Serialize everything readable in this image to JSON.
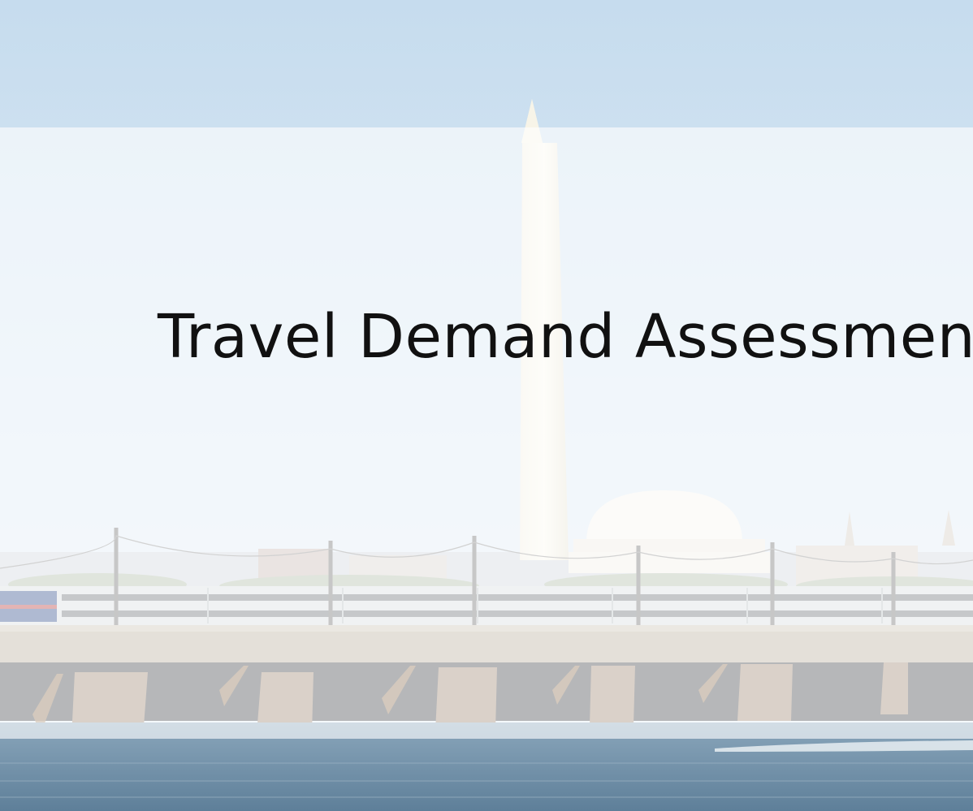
{
  "slide": {
    "title": "Travel Demand Assessment"
  },
  "colors": {
    "sky_top": "#c9dff0",
    "sky_mid": "#e4eef7",
    "water": "#6f8fa8",
    "text": "#111111"
  }
}
